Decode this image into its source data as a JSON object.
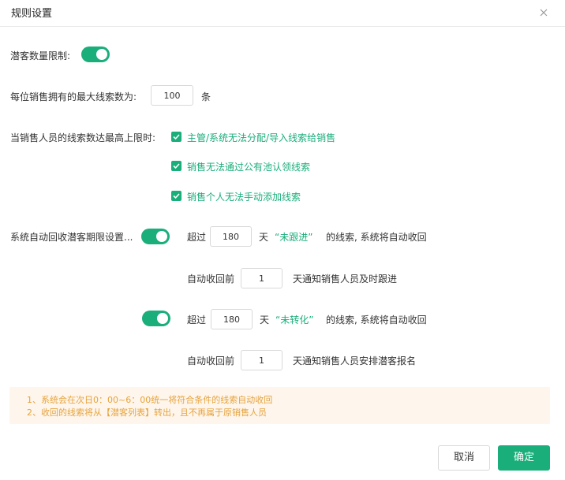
{
  "dialog": {
    "title": "规则设置",
    "close_icon": "close-icon"
  },
  "limit": {
    "label": "潜客数量限制:",
    "enabled": true
  },
  "max_leads": {
    "label": "每位销售拥有的最大线索数为:",
    "value": "100",
    "unit": "条"
  },
  "when_limit": {
    "label": "当销售人员的线索数达最高上限时:",
    "options": [
      {
        "label": "主管/系统无法分配/导入线索给销售",
        "checked": true
      },
      {
        "label": "销售无法通过公有池认领线索",
        "checked": true
      },
      {
        "label": "销售个人无法手动添加线索",
        "checked": true
      }
    ]
  },
  "auto_recycle": {
    "label": "系统自动回收潜客期限设置...",
    "rules": [
      {
        "enabled": true,
        "prefix": "超过",
        "days": "180",
        "days_unit": "天",
        "status": "“未跟进”",
        "suffix": "的线索, 系统将自动收回",
        "notify_prefix": "自动收回前",
        "notify_days": "1",
        "notify_suffix": "天通知销售人员及时跟进"
      },
      {
        "enabled": true,
        "prefix": "超过",
        "days": "180",
        "days_unit": "天",
        "status": "“未转化”",
        "suffix": "的线索, 系统将自动收回",
        "notify_prefix": "自动收回前",
        "notify_days": "1",
        "notify_suffix": "天通知销售人员安排潜客报名"
      }
    ]
  },
  "notice": {
    "lines": [
      "1、系统会在次日0：00~6：00统一将符合条件的线索自动收回",
      "2、收回的线索将从【潜客列表】转出，且不再属于原销售人员"
    ]
  },
  "footer": {
    "cancel_label": "取消",
    "ok_label": "确定"
  },
  "colors": {
    "accent": "#1aae7a",
    "notice_bg": "#fef6ec",
    "notice_text": "#e6a23c"
  }
}
